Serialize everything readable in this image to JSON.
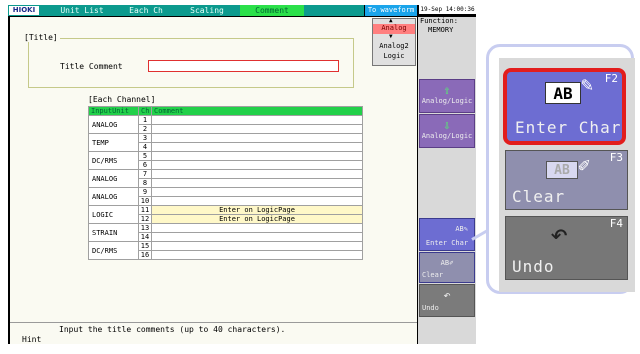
{
  "topbar": {
    "logo": "HIOKI",
    "tabs": [
      "Unit List",
      "Each Ch",
      "Scaling",
      "Comment"
    ],
    "active_tab": "Comment",
    "to_waveform": "To waveform",
    "datetime": "19-Sep 14:00:36"
  },
  "function": {
    "label": "Function:",
    "value": "MEMORY"
  },
  "analog_selector": {
    "items": [
      "Analog",
      "Analog2",
      "Logic"
    ]
  },
  "title_section": {
    "header": "[Title]",
    "label": "Title Comment",
    "value": ""
  },
  "channel_section": {
    "header": "[Each Channel]",
    "columns": [
      "InputUnit",
      "Ch",
      "Comment"
    ],
    "rows": [
      {
        "unit": "ANALOG",
        "chs": [
          "1",
          "2"
        ],
        "comments": [
          "",
          ""
        ]
      },
      {
        "unit": "TEMP",
        "chs": [
          "3",
          "4"
        ],
        "comments": [
          "",
          ""
        ]
      },
      {
        "unit": "DC/RMS",
        "chs": [
          "5",
          "6"
        ],
        "comments": [
          "",
          ""
        ]
      },
      {
        "unit": "ANALOG",
        "chs": [
          "7",
          "8"
        ],
        "comments": [
          "",
          ""
        ]
      },
      {
        "unit": "ANALOG",
        "chs": [
          "9",
          "10"
        ],
        "comments": [
          "",
          ""
        ]
      },
      {
        "unit": "LOGIC",
        "chs": [
          "11",
          "12"
        ],
        "comments": [
          "Enter on LogicPage",
          "Enter on LogicPage"
        ]
      },
      {
        "unit": "STRAIN",
        "chs": [
          "13",
          "14"
        ],
        "comments": [
          "",
          ""
        ]
      },
      {
        "unit": "DC/RMS",
        "chs": [
          "15",
          "16"
        ],
        "comments": [
          "",
          ""
        ]
      }
    ]
  },
  "hint": {
    "text": "Input the title comments (up to 40 characters).",
    "label": "Hint"
  },
  "side_buttons": {
    "analog_logic_1": "Analog/Logic",
    "analog_logic_2": "Analog/Logic",
    "enter_char": "Enter Char",
    "clear": "Clear",
    "undo": "Undo"
  },
  "zoom": {
    "f2_label": "Enter Char",
    "f3_label": "Clear",
    "f4_label": "Undo",
    "f2_key": "F2",
    "f3_key": "F3",
    "f4_key": "F4",
    "ab_text": "AB"
  },
  "colors": {
    "topbar": "#0c9a8e",
    "active_tab": "#2be04a",
    "to_waveform": "#1aa4ea",
    "highlight": "#e21d1d"
  }
}
